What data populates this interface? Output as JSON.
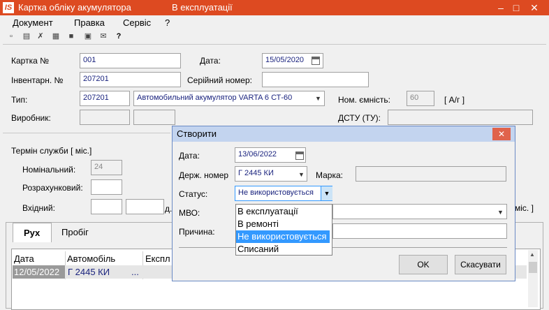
{
  "window": {
    "logo": "IS",
    "title": "Картка обліку акумулятора",
    "subtitle": "В експлуатації",
    "minimize": "–",
    "maximize": "□",
    "close": "✕"
  },
  "menu": [
    "Документ",
    "Правка",
    "Сервіс",
    "?"
  ],
  "form": {
    "card_label": "Картка №",
    "card_value": "001",
    "date_label": "Дата:",
    "date_value": "15/05/2020",
    "inv_label": "Інвентарн. №",
    "inv_value": "207201",
    "serial_label": "Серійний номер:",
    "serial_value": "",
    "type_label": "Тип:",
    "type_code": "207201",
    "type_name": "Автомобильний акумулятор VARTA 6 СТ-60",
    "capacity_label": "Ном. ємність:",
    "capacity_value": "60",
    "capacity_unit": "[ А/г ]",
    "maker_label": "Виробник:",
    "dstu_label": "ДСТУ (ТУ):",
    "service_label": "Термін служби [ міс.]",
    "nominal_label": "Номінальний:",
    "nominal_value": "24",
    "calc_label": "Розрахунковий:",
    "input_label": "Вхідний:",
    "partial_d": "д.",
    "partial_mis": "міс. ]"
  },
  "tabs": [
    "Рух",
    "Пробіг"
  ],
  "grid": {
    "headers": [
      "Дата",
      "Автомобіль",
      "Експл"
    ],
    "rows": [
      [
        "12/05/2022",
        "Г 2445 КИ",
        "..."
      ]
    ]
  },
  "dialog": {
    "title": "Створити",
    "date_label": "Дата:",
    "date_value": "13/06/2022",
    "plate_label": "Держ. номер",
    "plate_value": "Г 2445 КИ",
    "brand_label": "Марка:",
    "status_label": "Статус:",
    "status_value": "Не використовується",
    "mvo_label": "МВО:",
    "reason_label": "Причина:",
    "ok": "OK",
    "cancel": "Скасувати",
    "status_options": [
      "В експлуатації",
      "В ремонті",
      "Не використовується",
      "Списаний"
    ]
  },
  "colors": {
    "titlebar": "#dd4a21",
    "dialog_title": "#c3d4ef",
    "selection": "#3399ff",
    "text_blue": "#1a237e"
  }
}
